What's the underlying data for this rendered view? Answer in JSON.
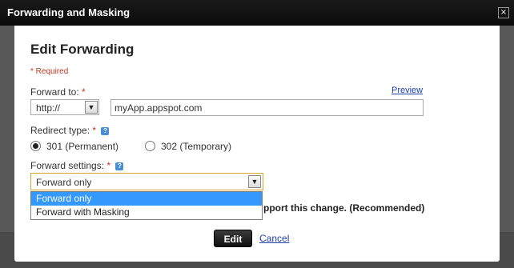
{
  "dialog": {
    "title": "Forwarding and Masking",
    "close_label": "×"
  },
  "form": {
    "heading": "Edit Forwarding",
    "required_note": "* Required",
    "forward_to": {
      "label": "Forward to:",
      "star": "*",
      "preview_link": "Preview",
      "protocol": "http://",
      "url_value": "myApp.appspot.com"
    },
    "redirect_type": {
      "label": "Redirect type:",
      "star": "*",
      "help": "?",
      "options": [
        {
          "label": "301 (Permanent)",
          "checked": true
        },
        {
          "label": "302 (Temporary)",
          "checked": false
        }
      ]
    },
    "forward_settings": {
      "label": "Forward settings:",
      "star": "*",
      "help": "?",
      "selected": "Forward only",
      "options": [
        "Forward only",
        "Forward with Masking"
      ],
      "highlighted_index": 0
    },
    "support_text": "pport this change. (Recommended)",
    "edit_button": "Edit",
    "cancel_link": "Cancel"
  },
  "colors": {
    "accent_link": "#1f3fa8",
    "required": "#c4371f",
    "highlight": "#3399ff"
  }
}
